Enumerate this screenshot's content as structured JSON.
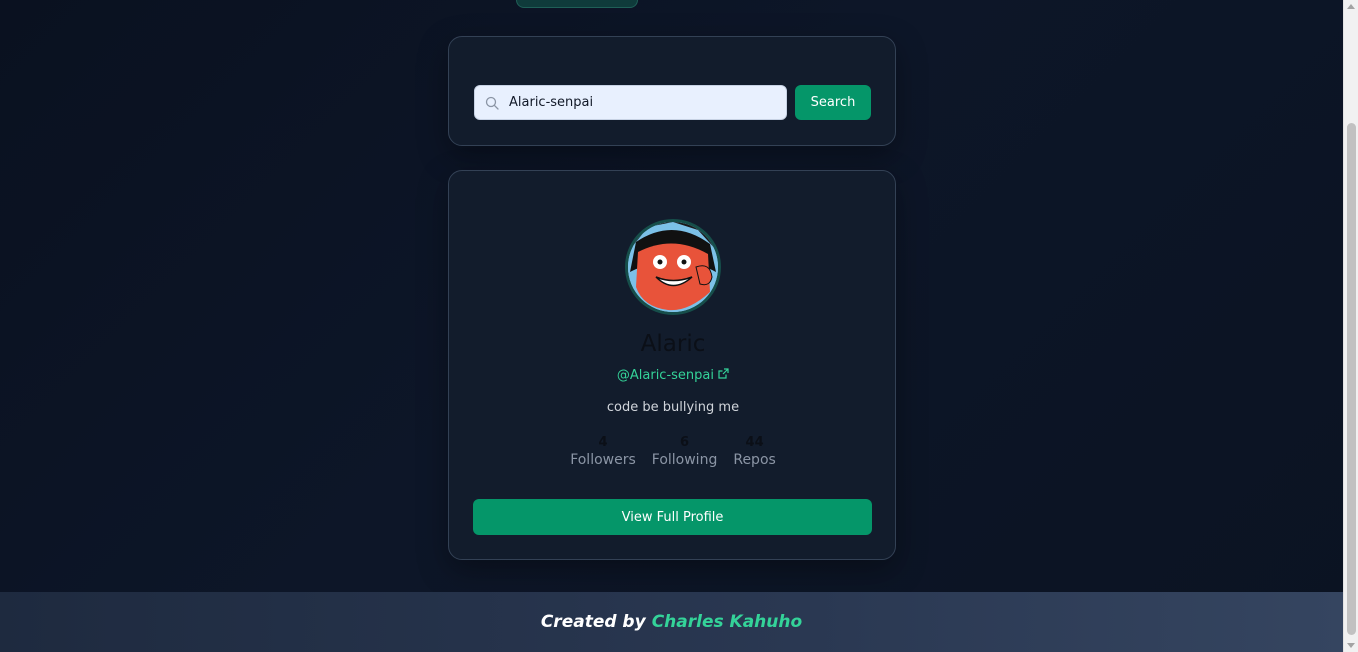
{
  "search": {
    "value": "Alaric-senpai",
    "button_label": "Search"
  },
  "profile": {
    "name": "Alaric",
    "handle": "@Alaric-senpai",
    "bio": "code be bullying me",
    "stats": [
      {
        "value": "4",
        "label": "Followers"
      },
      {
        "value": "6",
        "label": "Following"
      },
      {
        "value": "44",
        "label": "Repos"
      }
    ],
    "view_button_label": "View Full Profile"
  },
  "footer": {
    "prefix": "Created by",
    "author": "Charles Kahuho"
  },
  "colors": {
    "accent": "#059669",
    "link": "#34d399",
    "card_bg": "#121c2c",
    "page_bg": "#0b1322"
  },
  "icons": {
    "search": "search-icon",
    "external": "external-link-icon",
    "avatar": "avatar-image"
  }
}
